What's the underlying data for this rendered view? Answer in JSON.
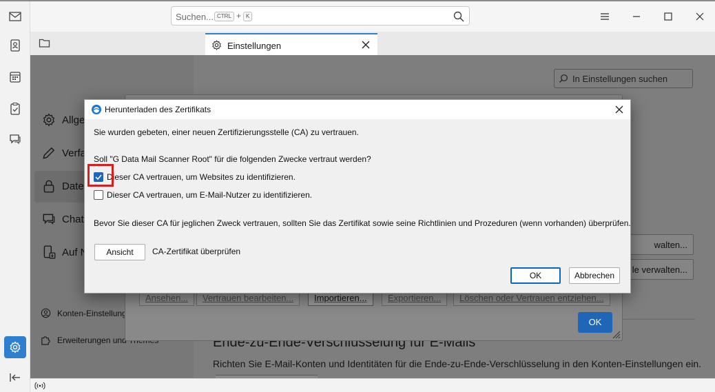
{
  "window": {
    "search_placeholder": "Suchen...",
    "search_kbd_ctrl": "CTRL",
    "search_kbd_plus": "+",
    "search_kbd_k": "K"
  },
  "tab": {
    "label": "Einstellungen"
  },
  "settings_nav": {
    "items": [
      {
        "label": "Allgemein",
        "visible": "Allge"
      },
      {
        "label": "Verfassen",
        "visible": "Verfa"
      },
      {
        "label": "Datenschutz & Sicherheit",
        "visible": "Date"
      },
      {
        "label": "Chat",
        "visible": "Chat"
      },
      {
        "label": "Auf Nachrichten",
        "visible": "Auf N"
      }
    ],
    "account_settings": "Konten-Einstellungen",
    "addons_themes": "Erweiterungen und Themes"
  },
  "settings_main": {
    "search_placeholder": "In Einstellungen suchen",
    "manage_btn_1": "walten...",
    "manage_btn_2": "le verwalten...",
    "e2e_title": "Ende-zu-Ende-Verschlüsselung für E-Mails",
    "e2e_text": "Richten Sie E-Mail-Konten und Identitäten für die Ende-zu-Ende-Verschlüsselung in den Konten-Einstellungen ein."
  },
  "cert_manager": {
    "buttons": [
      "Ansehen...",
      "Vertrauen bearbeiten...",
      "Importieren...",
      "Exportieren...",
      "Löschen oder Vertrauen entziehen..."
    ],
    "ok_label": "OK"
  },
  "dialog": {
    "title": "Herunterladen des Zertifikats",
    "intro": "Sie wurden gebeten, einer neuen Zertifizierungsstelle (CA) zu vertrauen.",
    "question": "Soll \"G Data Mail Scanner Root\" für die folgenden Zwecke vertraut werden?",
    "checkbox_websites": {
      "label": "Dieser CA vertrauen, um Websites zu identifizieren.",
      "checked": true
    },
    "checkbox_email": {
      "label": "Dieser CA vertrauen, um E-Mail-Nutzer zu identifizieren.",
      "checked": false
    },
    "advice": "Bevor Sie dieser CA für jeglichen Zweck vertrauen, sollten Sie das Zertifikat sowie seine Richtlinien und Prozeduren (wenn vorhanden) überprüfen.",
    "view_button": "Ansicht",
    "view_desc": "CA-Zertifikat überprüfen",
    "ok_button": "OK",
    "cancel_button": "Abbrechen"
  },
  "colors": {
    "accent": "#1f66b8",
    "highlight": "#d42020"
  }
}
